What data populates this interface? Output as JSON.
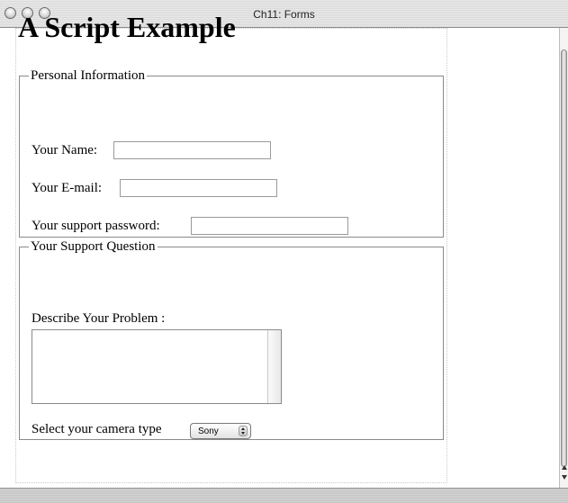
{
  "window": {
    "title": "Ch11: Forms"
  },
  "page": {
    "heading": "A Script Example"
  },
  "personal": {
    "legend": "Personal Information",
    "name_label": "Your Name:",
    "email_label": "Your E-mail:",
    "password_label": "Your support password:"
  },
  "support": {
    "legend": "Your Support Question",
    "problem_label": "Describe Your Problem :",
    "camera_label": "Select your camera type",
    "camera_selected": "Sony"
  }
}
